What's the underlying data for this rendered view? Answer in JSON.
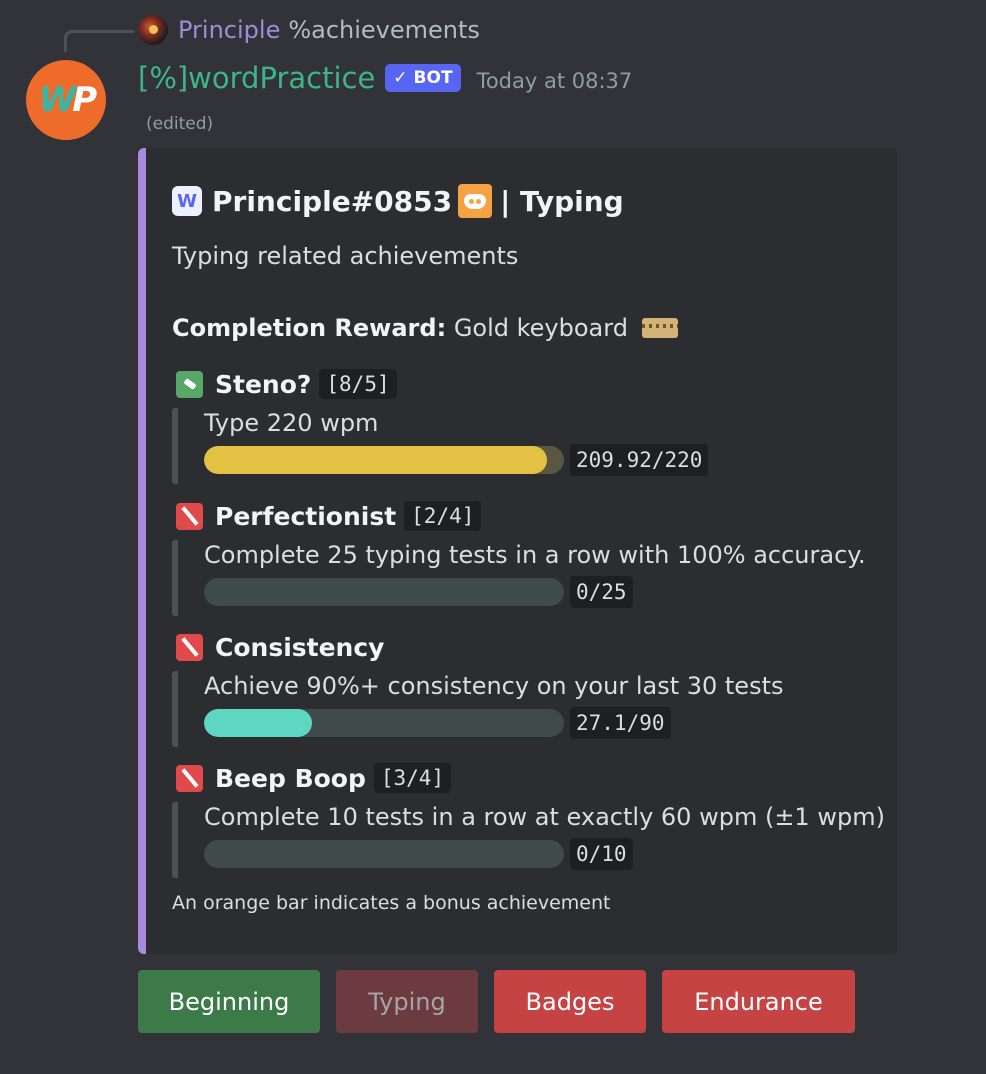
{
  "reply": {
    "author": "Principle",
    "command": "%achievements"
  },
  "message": {
    "author": "[%]wordPractice",
    "bot_tag": "BOT",
    "timestamp": "Today at 08:37",
    "edited": "(edited)",
    "avatar_text": "WP"
  },
  "embed": {
    "title_user": "Principle#0853",
    "title_suffix": "| Typing",
    "title_icon_letter": "W",
    "description": "Typing related achievements",
    "reward_label": "Completion Reward:",
    "reward_value": "Gold keyboard",
    "footer_note": "An orange bar indicates a bonus achievement",
    "accent_color": "#a78be0"
  },
  "achievements": [
    {
      "name": "Steno?",
      "count": "[8/5]",
      "status": "complete",
      "description": "Type 220 wpm",
      "progress_text": "209.92/220",
      "progress": 0.954,
      "bar_color": "#e3c142"
    },
    {
      "name": "Perfectionist",
      "count": "[2/4]",
      "status": "incomplete",
      "description": "Complete 25 typing tests in a row with 100% accuracy.",
      "progress_text": "0/25",
      "progress": 0,
      "bar_color": "#5fd6c1"
    },
    {
      "name": "Consistency",
      "count": "",
      "status": "incomplete",
      "description": "Achieve 90%+ consistency on your last 30 tests",
      "progress_text": "27.1/90",
      "progress": 0.301,
      "bar_color": "#5fd6c1"
    },
    {
      "name": "Beep Boop",
      "count": "[3/4]",
      "status": "incomplete",
      "description": "Complete 10 tests in a row at exactly 60 wpm (±1 wpm)",
      "progress_text": "0/10",
      "progress": 0,
      "bar_color": "#5fd6c1"
    }
  ],
  "buttons": [
    {
      "label": "Beginning",
      "style": "success"
    },
    {
      "label": "Typing",
      "style": "disabled"
    },
    {
      "label": "Badges",
      "style": "danger"
    },
    {
      "label": "Endurance",
      "style": "danger"
    }
  ]
}
